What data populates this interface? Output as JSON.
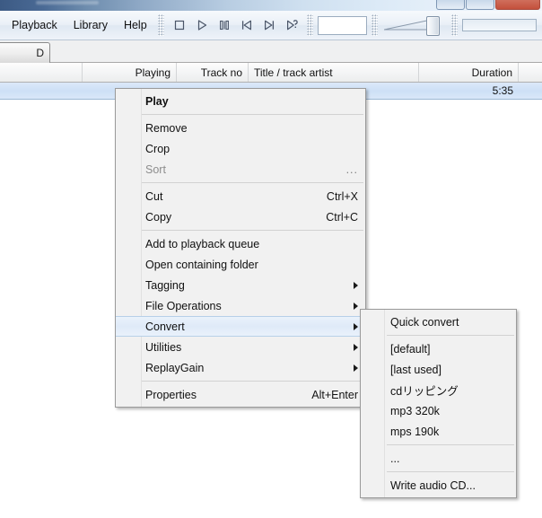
{
  "window": {
    "buttons": [
      "minimize",
      "maximize",
      "close"
    ]
  },
  "menubar": {
    "items": [
      {
        "label": "Playback",
        "name": "menubar-item-playback"
      },
      {
        "label": "Library",
        "name": "menubar-item-library"
      },
      {
        "label": "Help",
        "name": "menubar-item-help"
      }
    ]
  },
  "transport": {
    "buttons": [
      {
        "icon": "stop-icon",
        "label": "Stop"
      },
      {
        "icon": "play-icon",
        "label": "Play"
      },
      {
        "icon": "pause-icon",
        "label": "Pause"
      },
      {
        "icon": "previous-icon",
        "label": "Previous"
      },
      {
        "icon": "next-icon",
        "label": "Next"
      },
      {
        "icon": "random-icon",
        "label": "Random"
      }
    ]
  },
  "search": {
    "value": "",
    "placeholder": ""
  },
  "volume": {
    "icon": "volume-slider",
    "level": 88
  },
  "seekbar": {
    "icon": "seek-slider",
    "position": 0
  },
  "tabs": [
    {
      "label": "D",
      "name": "tab-playlist",
      "active": true
    }
  ],
  "columns": [
    {
      "label": "",
      "name": "column-header-blank",
      "width": 92,
      "align": "l"
    },
    {
      "label": "Playing",
      "name": "column-header-playing",
      "width": 105,
      "align": "r"
    },
    {
      "label": "Track no",
      "name": "column-header-track-no",
      "width": 80,
      "align": "r"
    },
    {
      "label": "Title / track artist",
      "name": "column-header-title-track-artist",
      "width": 190,
      "align": "l"
    },
    {
      "label": "Duration",
      "name": "column-header-duration",
      "width": 111,
      "align": "r"
    },
    {
      "label": "",
      "name": "column-header-spacer",
      "width": 26,
      "align": "l"
    }
  ],
  "playlist": {
    "selected_row": {
      "blank": "",
      "playing": "",
      "track_no": "",
      "title": "",
      "duration": "5:35",
      "spacer": ""
    }
  },
  "context_menu": {
    "items": [
      {
        "label": "Play",
        "accel": "",
        "name": "menu-item-play",
        "style": "bold"
      },
      {
        "type": "separator",
        "name": "menu-separator-1"
      },
      {
        "label": "Remove",
        "accel": "",
        "name": "menu-item-remove"
      },
      {
        "label": "Crop",
        "accel": "",
        "name": "menu-item-crop"
      },
      {
        "label": "Sort",
        "accel": "",
        "dots": "...",
        "name": "menu-item-sort",
        "style": "disabled"
      },
      {
        "type": "separator",
        "name": "menu-separator-2"
      },
      {
        "label": "Cut",
        "accel": "Ctrl+X",
        "name": "menu-item-cut"
      },
      {
        "label": "Copy",
        "accel": "Ctrl+C",
        "name": "menu-item-copy"
      },
      {
        "type": "separator",
        "name": "menu-separator-3"
      },
      {
        "label": "Add to playback queue",
        "accel": "",
        "name": "menu-item-add-to-playback-queue"
      },
      {
        "label": "Open containing folder",
        "accel": "",
        "name": "menu-item-open-containing-folder"
      },
      {
        "label": "Tagging",
        "accel": "",
        "submenu": true,
        "name": "menu-item-tagging"
      },
      {
        "label": "File Operations",
        "accel": "",
        "submenu": true,
        "name": "menu-item-file-operations"
      },
      {
        "label": "Convert",
        "accel": "",
        "submenu": true,
        "name": "menu-item-convert",
        "style": "selected"
      },
      {
        "label": "Utilities",
        "accel": "",
        "submenu": true,
        "name": "menu-item-utilities"
      },
      {
        "label": "ReplayGain",
        "accel": "",
        "submenu": true,
        "name": "menu-item-replaygain"
      },
      {
        "type": "separator",
        "name": "menu-separator-4"
      },
      {
        "label": "Properties",
        "accel": "Alt+Enter",
        "name": "menu-item-properties"
      }
    ]
  },
  "convert_submenu": {
    "items": [
      {
        "label": "Quick convert",
        "name": "submenu-item-quick-convert"
      },
      {
        "type": "separator",
        "name": "submenu-separator-1"
      },
      {
        "label": "[default]",
        "name": "submenu-item-default"
      },
      {
        "label": "[last used]",
        "name": "submenu-item-last-used"
      },
      {
        "label": "cdリッピング",
        "name": "submenu-item-cd-ripping"
      },
      {
        "label": "mp3 320k",
        "name": "submenu-item-mp3-320k"
      },
      {
        "label": "mps 190k",
        "name": "submenu-item-mps-190k"
      },
      {
        "type": "separator",
        "name": "submenu-separator-2"
      },
      {
        "label": "...",
        "name": "submenu-item-more"
      },
      {
        "type": "separator",
        "name": "submenu-separator-3"
      },
      {
        "label": "Write audio CD...",
        "name": "submenu-item-write-audio-cd"
      }
    ]
  },
  "colors": {
    "titlebar_start": "#3c5a84",
    "titlebar_end": "#f0f6fc",
    "menu_bg": "#f1f1f1",
    "selection_blue": "#cde0f6",
    "close_button_red": "#c4503c"
  }
}
